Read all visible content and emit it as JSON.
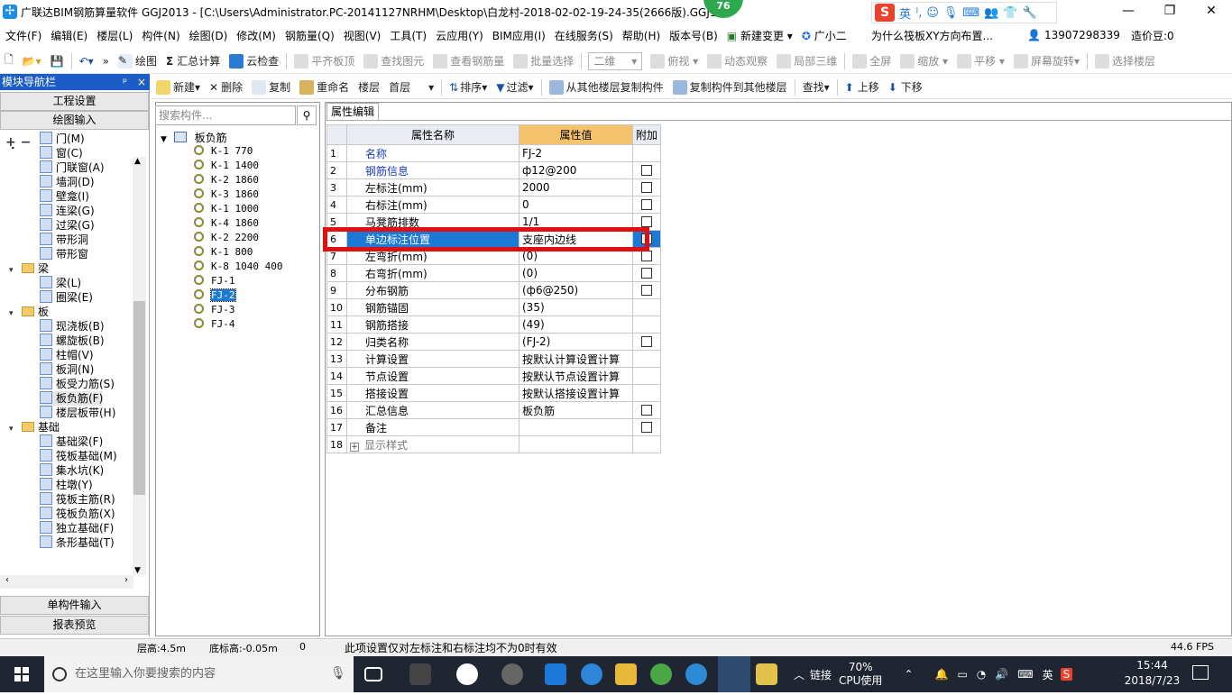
{
  "window": {
    "title": "广联达BIM钢筋算量软件 GGJ2013 - [C:\\Users\\Administrator.PC-20141127NRHM\\Desktop\\白龙村-2018-02-02-19-24-35(2666版).GGJ12]",
    "badge": "76",
    "minimize": "—",
    "restore": "❐",
    "close": "✕"
  },
  "ime": {
    "logo": "S",
    "mode": "英"
  },
  "menu": {
    "items": [
      "文件(F)",
      "编辑(E)",
      "楼层(L)",
      "构件(N)",
      "绘图(D)",
      "修改(M)",
      "钢筋量(Q)",
      "视图(V)",
      "工具(T)",
      "云应用(Y)",
      "BIM应用(I)",
      "在线服务(S)",
      "帮助(H)",
      "版本号(B)",
      "新建变更",
      "广小二"
    ],
    "question": "为什么筏板XY方向布置...",
    "phone": "13907298339",
    "coins": "造价豆:0"
  },
  "toolbar1": {
    "draw": "绘图",
    "sum": "汇总计算",
    "cloud_check": "云检查",
    "flush": "平齐板顶",
    "find": "查找图元",
    "view_rebar": "查看钢筋量",
    "batch": "批量选择",
    "view_mode": "二维",
    "top_view": "俯视",
    "dynamic": "动态观察",
    "local3d": "局部三维",
    "fullscreen": "全屏",
    "zoom": "缩放",
    "pan": "平移",
    "rotate": "屏幕旋转",
    "select_floor": "选择楼层"
  },
  "toolbar2": {
    "new": "新建",
    "delete": "删除",
    "copy": "复制",
    "rename": "重命名",
    "floor_label": "楼层",
    "floor_value": "首层",
    "sort": "排序",
    "filter": "过滤",
    "copy_from": "从其他楼层复制构件",
    "copy_to": "复制构件到其他楼层",
    "find": "查找",
    "up": "上移",
    "down": "下移"
  },
  "left_panel": {
    "title": "模块导航栏",
    "pin": "ᵖ",
    "close": "×",
    "btn_project": "工程设置",
    "btn_draw": "绘图输入",
    "btn_single": "单构件输入",
    "btn_report": "报表预览",
    "tree": [
      {
        "label": "门(M)",
        "level": 2
      },
      {
        "label": "窗(C)",
        "level": 2
      },
      {
        "label": "门联窗(A)",
        "level": 2
      },
      {
        "label": "墙洞(D)",
        "level": 2
      },
      {
        "label": "壁龛(I)",
        "level": 2
      },
      {
        "label": "连梁(G)",
        "level": 2
      },
      {
        "label": "过梁(G)",
        "level": 2
      },
      {
        "label": "带形洞",
        "level": 2
      },
      {
        "label": "带形窗",
        "level": 2
      },
      {
        "label": "梁",
        "level": 1
      },
      {
        "label": "梁(L)",
        "level": 2
      },
      {
        "label": "圈梁(E)",
        "level": 2
      },
      {
        "label": "板",
        "level": 1
      },
      {
        "label": "现浇板(B)",
        "level": 2
      },
      {
        "label": "螺旋板(B)",
        "level": 2
      },
      {
        "label": "柱帽(V)",
        "level": 2
      },
      {
        "label": "板洞(N)",
        "level": 2
      },
      {
        "label": "板受力筋(S)",
        "level": 2
      },
      {
        "label": "板负筋(F)",
        "level": 2
      },
      {
        "label": "楼层板带(H)",
        "level": 2
      },
      {
        "label": "基础",
        "level": 1
      },
      {
        "label": "基础梁(F)",
        "level": 2
      },
      {
        "label": "筏板基础(M)",
        "level": 2
      },
      {
        "label": "集水坑(K)",
        "level": 2
      },
      {
        "label": "柱墩(Y)",
        "level": 2
      },
      {
        "label": "筏板主筋(R)",
        "level": 2
      },
      {
        "label": "筏板负筋(X)",
        "level": 2
      },
      {
        "label": "独立基础(F)",
        "level": 2
      },
      {
        "label": "条形基础(T)",
        "level": 2
      }
    ]
  },
  "mid_panel": {
    "search_placeholder": "搜索构件...",
    "root": "板负筋",
    "items": [
      "K-1 770",
      "K-1 1400",
      "K-2 1860",
      "K-3 1860",
      "K-1 1000",
      "K-4 1860",
      "K-2 2200",
      "K-1 800",
      "K-8 1040 400",
      "FJ-1",
      "FJ-2",
      "FJ-3",
      "FJ-4"
    ],
    "selected": "FJ-2"
  },
  "property_panel": {
    "tab": "属性编辑",
    "headers": {
      "name": "属性名称",
      "value": "属性值",
      "extra": "附加"
    },
    "rows": [
      {
        "n": "1",
        "name": "名称",
        "value": "FJ-2",
        "cb": false,
        "blue": true
      },
      {
        "n": "2",
        "name": "钢筋信息",
        "value": "ф12@200",
        "cb": true,
        "blue": true
      },
      {
        "n": "3",
        "name": "左标注(mm)",
        "value": "2000",
        "cb": true,
        "blue": false
      },
      {
        "n": "4",
        "name": "右标注(mm)",
        "value": "0",
        "cb": true,
        "blue": false
      },
      {
        "n": "5",
        "name": "马凳筋排数",
        "value": "1/1",
        "cb": true,
        "blue": false
      },
      {
        "n": "6",
        "name": "单边标注位置",
        "value": "支座内边线",
        "cb": true,
        "blue": false
      },
      {
        "n": "7",
        "name": "左弯折(mm)",
        "value": "(0)",
        "cb": true,
        "blue": false
      },
      {
        "n": "8",
        "name": "右弯折(mm)",
        "value": "(0)",
        "cb": true,
        "blue": false
      },
      {
        "n": "9",
        "name": "分布钢筋",
        "value": "(ф6@250)",
        "cb": true,
        "blue": false
      },
      {
        "n": "10",
        "name": "钢筋锚固",
        "value": "(35)",
        "cb": false,
        "blue": false
      },
      {
        "n": "11",
        "name": "钢筋搭接",
        "value": "(49)",
        "cb": false,
        "blue": false
      },
      {
        "n": "12",
        "name": "归类名称",
        "value": "(FJ-2)",
        "cb": true,
        "blue": false
      },
      {
        "n": "13",
        "name": "计算设置",
        "value": "按默认计算设置计算",
        "cb": false,
        "blue": false
      },
      {
        "n": "14",
        "name": "节点设置",
        "value": "按默认节点设置计算",
        "cb": false,
        "blue": false
      },
      {
        "n": "15",
        "name": "搭接设置",
        "value": "按默认搭接设置计算",
        "cb": false,
        "blue": false
      },
      {
        "n": "16",
        "name": "汇总信息",
        "value": "板负筋",
        "cb": true,
        "blue": false
      },
      {
        "n": "17",
        "name": "备注",
        "value": "",
        "cb": true,
        "blue": false
      },
      {
        "n": "18",
        "name": "显示样式",
        "value": "",
        "cb": false,
        "blue": false
      }
    ],
    "selected_row": "6"
  },
  "status": {
    "floor_height": "层高:4.5m",
    "bottom_elev": "底标高:-0.05m",
    "zero": "0",
    "hint": "此项设置仅对左标注和右标注均不为0时有效",
    "fps": "44.6 FPS"
  },
  "taskbar": {
    "search_placeholder": "在这里输入你要搜索的内容",
    "link": "链接",
    "cpu_percent": "70%",
    "cpu_label": "CPU使用",
    "lang": "英",
    "time": "15:44",
    "date": "2018/7/23"
  }
}
